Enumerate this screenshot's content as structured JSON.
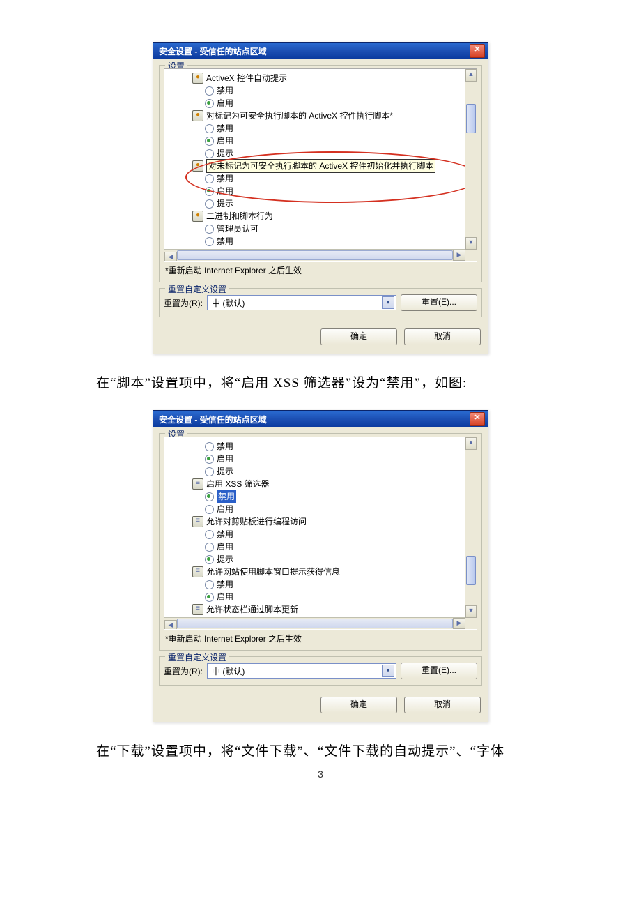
{
  "dialog1": {
    "title": "安全设置 - 受信任的站点区域",
    "group_settings": "设置",
    "items": [
      {
        "type": "cat",
        "label": "ActiveX 控件自动提示",
        "icon": "●"
      },
      {
        "type": "opt",
        "label": "禁用",
        "sel": false
      },
      {
        "type": "opt",
        "label": "启用",
        "sel": true
      },
      {
        "type": "cat",
        "label": "对标记为可安全执行脚本的 ActiveX 控件执行脚本*",
        "icon": "●"
      },
      {
        "type": "opt",
        "label": "禁用",
        "sel": false
      },
      {
        "type": "opt",
        "label": "启用",
        "sel": true
      },
      {
        "type": "opt",
        "label": "提示",
        "sel": false
      },
      {
        "type": "cat",
        "label": "对未标记为可安全执行脚本的 ActiveX 控件初始化并执行脚本",
        "icon": "●",
        "hl": true
      },
      {
        "type": "opt",
        "label": "禁用",
        "sel": false
      },
      {
        "type": "opt",
        "label": "启用",
        "sel": true
      },
      {
        "type": "opt",
        "label": "提示",
        "sel": false
      },
      {
        "type": "cat",
        "label": "二进制和脚本行为",
        "icon": "●"
      },
      {
        "type": "opt",
        "label": "管理员认可",
        "sel": false
      },
      {
        "type": "opt",
        "label": "禁用",
        "sel": false
      }
    ],
    "note": "*重新启动 Internet Explorer 之后生效",
    "group_reset": "重置自定义设置",
    "reset_to": "重置为(R):",
    "combo_value": "中 (默认)",
    "reset_btn": "重置(E)...",
    "ok": "确定",
    "cancel": "取消"
  },
  "para1": "在“脚本”设置项中，将“启用 XSS 筛选器”设为“禁用”，如图:",
  "dialog2": {
    "title": "安全设置 - 受信任的站点区域",
    "group_settings": "设置",
    "items": [
      {
        "type": "opt",
        "label": "禁用",
        "sel": false
      },
      {
        "type": "opt",
        "label": "启用",
        "sel": true
      },
      {
        "type": "opt",
        "label": "提示",
        "sel": false
      },
      {
        "type": "cat",
        "label": "启用 XSS 筛选器",
        "icon": "s"
      },
      {
        "type": "opt",
        "label": "禁用",
        "sel": true,
        "hlsel": true
      },
      {
        "type": "opt",
        "label": "启用",
        "sel": false
      },
      {
        "type": "cat",
        "label": "允许对剪贴板进行编程访问",
        "icon": "s"
      },
      {
        "type": "opt",
        "label": "禁用",
        "sel": false
      },
      {
        "type": "opt",
        "label": "启用",
        "sel": false
      },
      {
        "type": "opt",
        "label": "提示",
        "sel": true
      },
      {
        "type": "cat",
        "label": "允许网站使用脚本窗口提示获得信息",
        "icon": "s"
      },
      {
        "type": "opt",
        "label": "禁用",
        "sel": false
      },
      {
        "type": "opt",
        "label": "启用",
        "sel": true
      },
      {
        "type": "cat",
        "label": "允许状态栏通过脚本更新",
        "icon": "s"
      }
    ],
    "note": "*重新启动 Internet Explorer 之后生效",
    "group_reset": "重置自定义设置",
    "reset_to": "重置为(R):",
    "combo_value": "中 (默认)",
    "reset_btn": "重置(E)...",
    "ok": "确定",
    "cancel": "取消"
  },
  "para2": "在“下载”设置项中，将“文件下载”、“文件下载的自动提示”、“字体",
  "page_num": "3"
}
